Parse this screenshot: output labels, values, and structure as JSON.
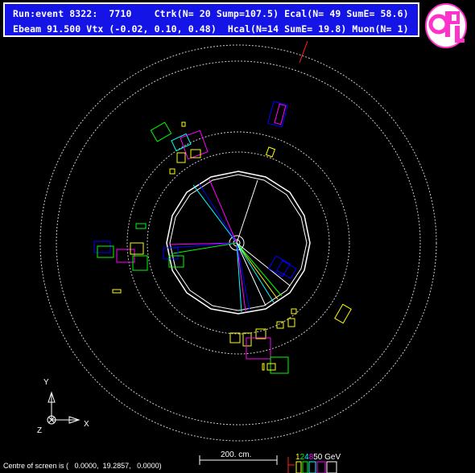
{
  "header": {
    "line1": "Run:event 8322:  7710    Ctrk(N= 20 Sump=107.5) Ecal(N= 49 SumE= 58.6)",
    "line2": "Ebeam 91.500 Vtx (-0.02, 0.10, 0.48)  Hcal(N=14 SumE= 19.8) Muon(N= 1)"
  },
  "logo": {
    "text": "OPAL",
    "color": "#ff33cc"
  },
  "axes": {
    "y": "Y",
    "x": "X",
    "z": "Z"
  },
  "scale": {
    "label": "200. cm."
  },
  "energy_legend": {
    "values": [
      "1",
      "2",
      "4",
      "8",
      "50 GeV"
    ],
    "colors": [
      "#ffff00",
      "#00ff00",
      "#00ffff",
      "#ff00ff",
      "#ffffff"
    ]
  },
  "footer": {
    "text": "Centre of screen is (   0.0000,  19.2857,   0.0000)"
  }
}
